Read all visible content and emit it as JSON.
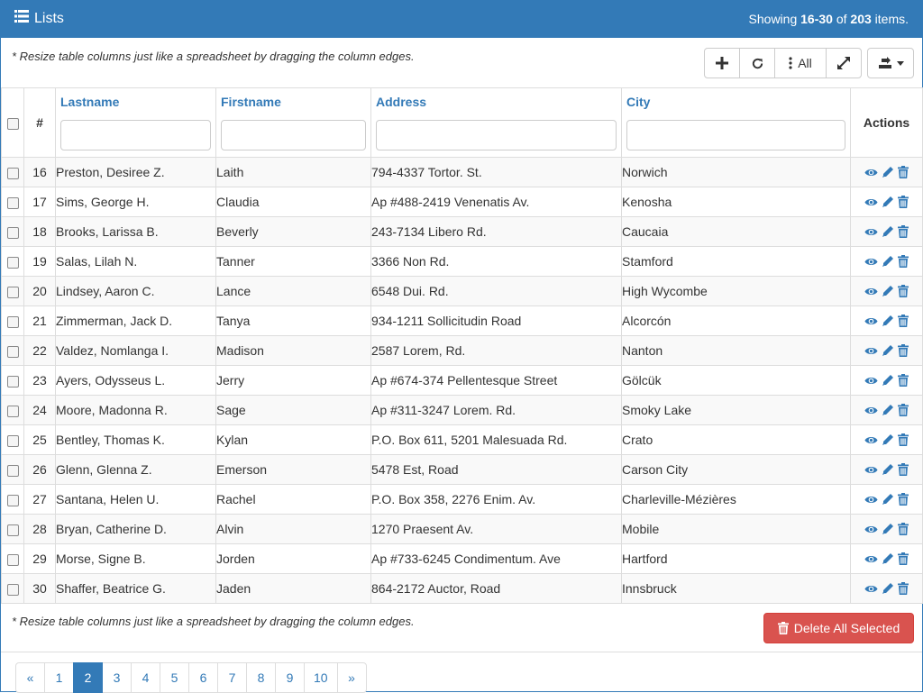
{
  "header": {
    "title": "Lists",
    "showing_prefix": "Showing ",
    "showing_range": "16-30",
    "showing_of": " of ",
    "showing_total": "203",
    "showing_suffix": " items."
  },
  "hint_text": "* Resize table columns just like a spreadsheet by dragging the column edges.",
  "toolbar": {
    "columns_label": "All"
  },
  "columns": {
    "hash": "#",
    "lastname": "Lastname",
    "firstname": "Firstname",
    "address": "Address",
    "city": "City",
    "actions": "Actions"
  },
  "rows": [
    {
      "id": "16",
      "lastname": "Preston, Desiree Z.",
      "firstname": "Laith",
      "address": "794-4337 Tortor. St.",
      "city": "Norwich"
    },
    {
      "id": "17",
      "lastname": "Sims, George H.",
      "firstname": "Claudia",
      "address": "Ap #488-2419 Venenatis Av.",
      "city": "Kenosha"
    },
    {
      "id": "18",
      "lastname": "Brooks, Larissa B.",
      "firstname": "Beverly",
      "address": "243-7134 Libero Rd.",
      "city": "Caucaia"
    },
    {
      "id": "19",
      "lastname": "Salas, Lilah N.",
      "firstname": "Tanner",
      "address": "3366 Non Rd.",
      "city": "Stamford"
    },
    {
      "id": "20",
      "lastname": "Lindsey, Aaron C.",
      "firstname": "Lance",
      "address": "6548 Dui. Rd.",
      "city": "High Wycombe"
    },
    {
      "id": "21",
      "lastname": "Zimmerman, Jack D.",
      "firstname": "Tanya",
      "address": "934-1211 Sollicitudin Road",
      "city": "Alcorcón"
    },
    {
      "id": "22",
      "lastname": "Valdez, Nomlanga I.",
      "firstname": "Madison",
      "address": "2587 Lorem, Rd.",
      "city": "Nanton"
    },
    {
      "id": "23",
      "lastname": "Ayers, Odysseus L.",
      "firstname": "Jerry",
      "address": "Ap #674-374 Pellentesque Street",
      "city": "Gölcük"
    },
    {
      "id": "24",
      "lastname": "Moore, Madonna R.",
      "firstname": "Sage",
      "address": "Ap #311-3247 Lorem. Rd.",
      "city": "Smoky Lake"
    },
    {
      "id": "25",
      "lastname": "Bentley, Thomas K.",
      "firstname": "Kylan",
      "address": "P.O. Box 611, 5201 Malesuada Rd.",
      "city": "Crato"
    },
    {
      "id": "26",
      "lastname": "Glenn, Glenna Z.",
      "firstname": "Emerson",
      "address": "5478 Est, Road",
      "city": "Carson City"
    },
    {
      "id": "27",
      "lastname": "Santana, Helen U.",
      "firstname": "Rachel",
      "address": "P.O. Box 358, 2276 Enim. Av.",
      "city": "Charleville-Mézières"
    },
    {
      "id": "28",
      "lastname": "Bryan, Catherine D.",
      "firstname": "Alvin",
      "address": "1270 Praesent Av.",
      "city": "Mobile"
    },
    {
      "id": "29",
      "lastname": "Morse, Signe B.",
      "firstname": "Jorden",
      "address": "Ap #733-6245 Condimentum. Ave",
      "city": "Hartford"
    },
    {
      "id": "30",
      "lastname": "Shaffer, Beatrice G.",
      "firstname": "Jaden",
      "address": "864-2172 Auctor, Road",
      "city": "Innsbruck"
    }
  ],
  "footer": {
    "delete_label": "Delete All Selected"
  },
  "pagination": {
    "prev": "«",
    "next": "»",
    "pages": [
      "1",
      "2",
      "3",
      "4",
      "5",
      "6",
      "7",
      "8",
      "9",
      "10"
    ],
    "active": "2"
  },
  "colors": {
    "primary": "#337ab7",
    "danger": "#d9534f"
  }
}
